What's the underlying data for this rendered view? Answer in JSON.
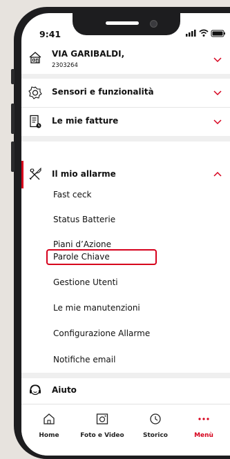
{
  "status": {
    "time": "9:41"
  },
  "address": {
    "title": "VIA GARIBALDI,",
    "code": "2303264"
  },
  "menu": {
    "sensori": "Sensori e funzionalità",
    "fatture": "Le mie fatture",
    "allarme": "Il mio allarme",
    "aiuto": "Aiuto"
  },
  "allarme_items": [
    "Fast ceck",
    "Status Batterie",
    "Piani d’Azione",
    "Parole Chiave",
    "Gestione Utenti",
    "Le mie manutenzioni",
    "Configurazione Allarme",
    "Notifiche email"
  ],
  "tabs": [
    {
      "label": "Home",
      "icon": "home-icon"
    },
    {
      "label": "Foto e Video",
      "icon": "photo-icon"
    },
    {
      "label": "Storico",
      "icon": "clock-icon"
    },
    {
      "label": "Menù",
      "icon": "more-dots-icon"
    }
  ],
  "colors": {
    "accent": "#d6001c",
    "text": "#111111"
  }
}
